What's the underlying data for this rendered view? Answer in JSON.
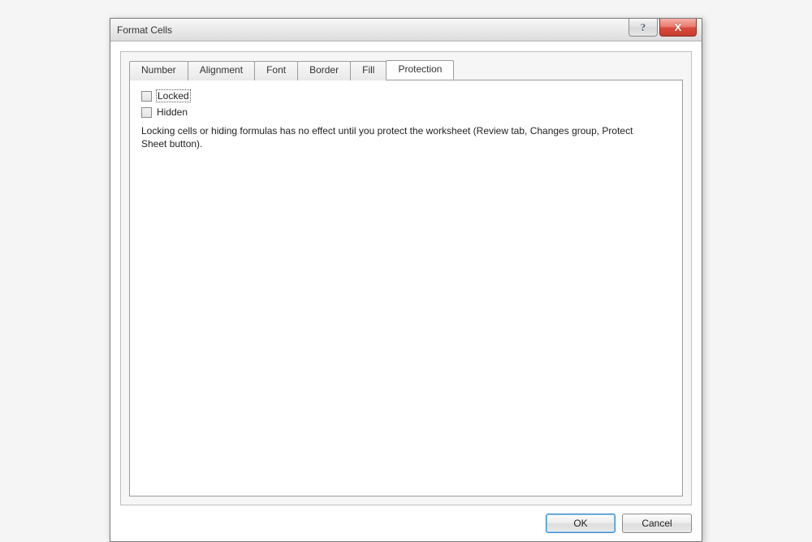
{
  "titlebar": {
    "title": "Format Cells",
    "help_tooltip": "?",
    "close_tooltip": "X"
  },
  "tabs": {
    "number": "Number",
    "alignment": "Alignment",
    "font": "Font",
    "border": "Border",
    "fill": "Fill",
    "protection": "Protection"
  },
  "protection": {
    "locked_label": "Locked",
    "hidden_label": "Hidden",
    "description": "Locking cells or hiding formulas has no effect until you protect the worksheet (Review tab, Changes group, Protect Sheet button)."
  },
  "buttons": {
    "ok": "OK",
    "cancel": "Cancel"
  }
}
